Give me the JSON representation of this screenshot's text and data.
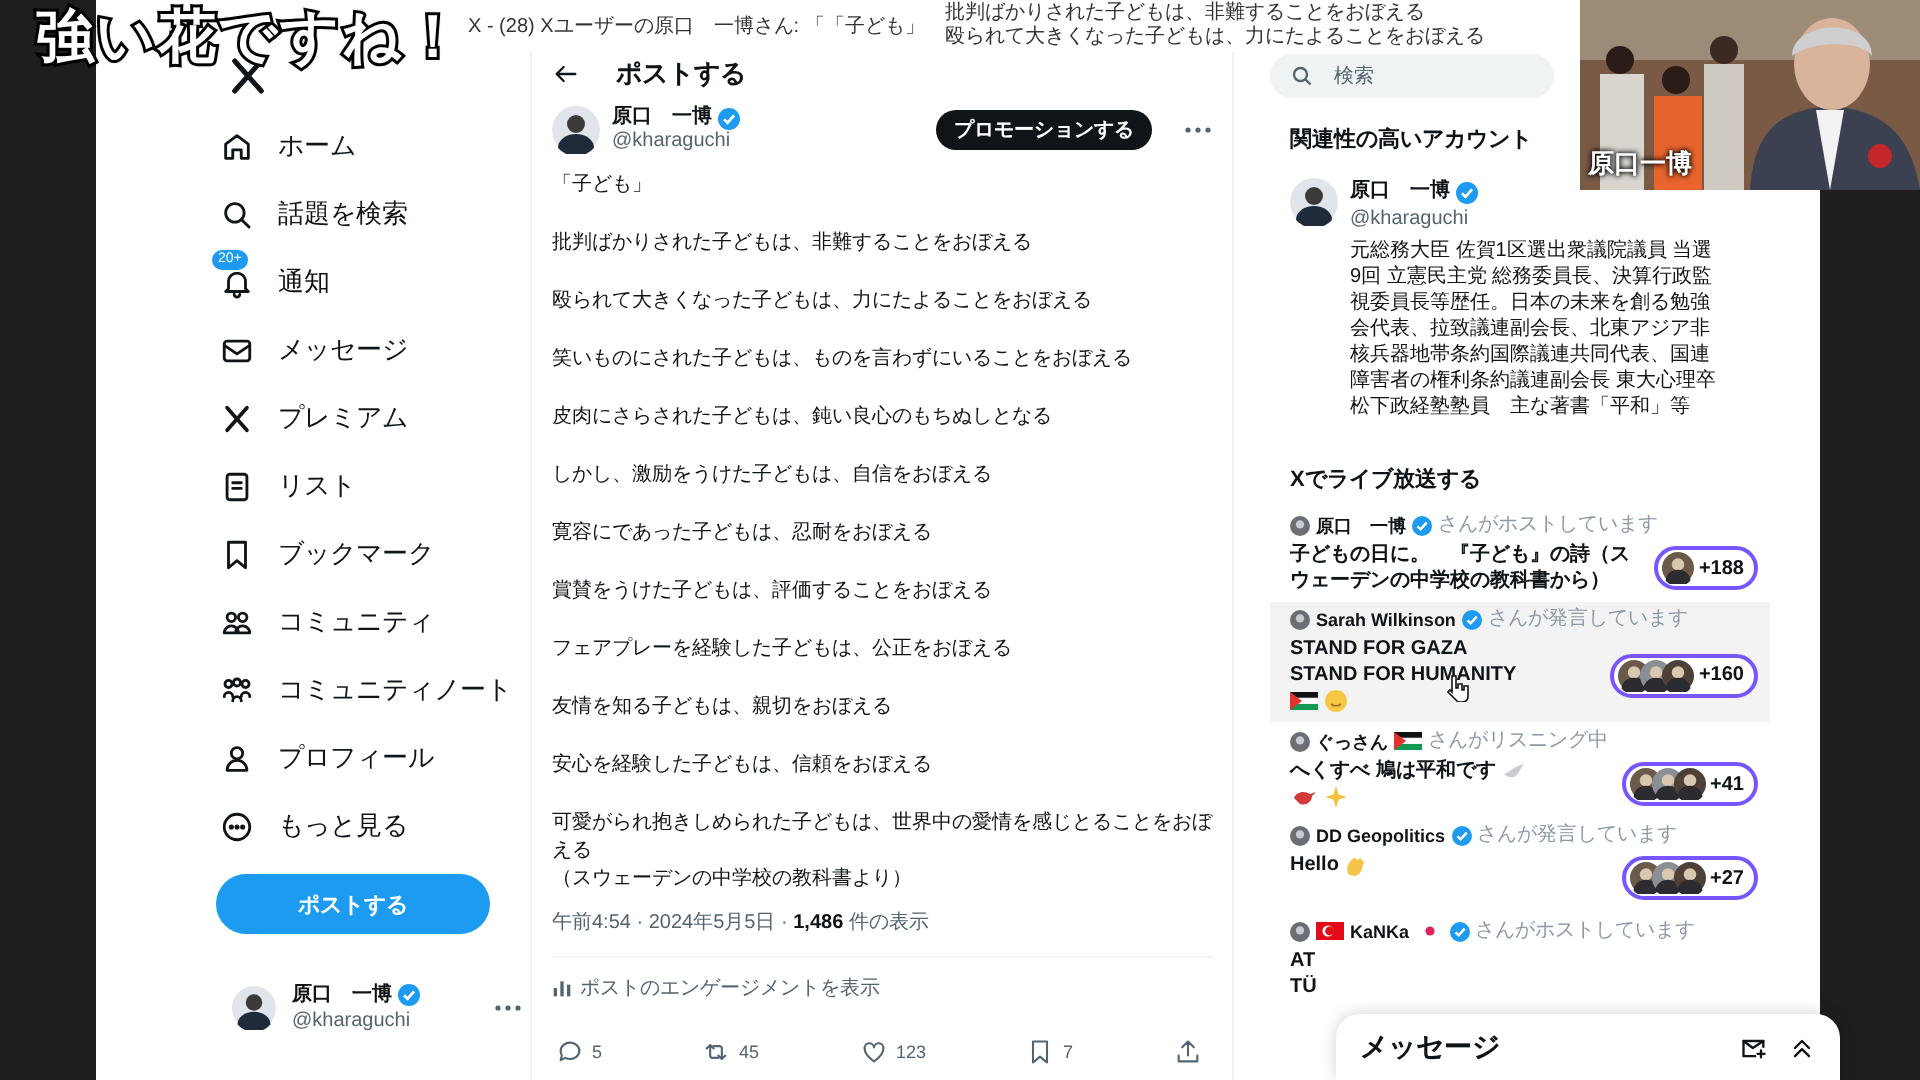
{
  "caption": {
    "text": "強い花ですね！"
  },
  "title_bar": {
    "page_title": "X - (28) Xユーザーの原口　一博さん: 「「子ども」",
    "post_preview": [
      "批判ばかりされた子どもは、非難することをおぼえる",
      "殴られて大きくなった子どもは、力にたよることをおぼえる"
    ]
  },
  "sidebar": {
    "items": [
      {
        "kind": "home",
        "label": "ホーム"
      },
      {
        "kind": "explore",
        "label": "話題を検索"
      },
      {
        "kind": "notifications",
        "label": "通知",
        "badge": "20+"
      },
      {
        "kind": "messages",
        "label": "メッセージ"
      },
      {
        "kind": "premium",
        "label": "プレミアム"
      },
      {
        "kind": "lists",
        "label": "リスト"
      },
      {
        "kind": "bookmarks",
        "label": "ブックマーク"
      },
      {
        "kind": "communities",
        "label": "コミュニティ"
      },
      {
        "kind": "notes",
        "label": "コミュニティノート"
      },
      {
        "kind": "profile",
        "label": "プロフィール"
      },
      {
        "kind": "more",
        "label": "もっと見る"
      }
    ],
    "post_button": "ポストする",
    "account": {
      "name": "原口　一博",
      "verified": true,
      "handle": "@kharaguchi"
    }
  },
  "post": {
    "header": "ポストする",
    "author": {
      "name": "原口　一博",
      "verified": true,
      "handle": "@kharaguchi"
    },
    "promote_button": "プロモーションする",
    "paragraphs": [
      "「子ども」",
      "批判ばかりされた子どもは、非難することをおぼえる",
      "殴られて大きくなった子どもは、力にたよることをおぼえる",
      "笑いものにされた子どもは、ものを言わずにいることをおぼえる",
      "皮肉にさらされた子どもは、鈍い良心のもちぬしとなる",
      "しかし、激励をうけた子どもは、自信をおぼえる",
      "寛容にであった子どもは、忍耐をおぼえる",
      "賞賛をうけた子どもは、評価することをおぼえる",
      "フェアプレーを経験した子どもは、公正をおぼえる",
      "友情を知る子どもは、親切をおぼえる",
      "安心を経験した子どもは、信頼をおぼえる",
      "可愛がられ抱きしめられた子どもは、世界中の愛情を感じとることをおぼえる"
    ],
    "source": "（スウェーデンの中学校の教科書より）",
    "meta": "午前4:54 · 2024年5月5日 · **1,486** 件の表示",
    "engagement_link": "ポストのエンゲージメントを表示",
    "actions": [
      {
        "kind": "reply",
        "count": "5"
      },
      {
        "kind": "repost",
        "count": "45"
      },
      {
        "kind": "like",
        "count": "123"
      },
      {
        "kind": "bookmark",
        "count": "7"
      },
      {
        "kind": "share"
      }
    ]
  },
  "right": {
    "search": {
      "placeholder": "検索"
    },
    "relevant": {
      "title": "関連性の高いアカウント",
      "account": {
        "name": "原口　一博",
        "verified": true,
        "handle": "@kharaguchi",
        "bio": "元総務大臣 佐賀1区選出衆議院議員 当選9回 立憲民主党 総務委員長、決算行政監視委員長等歴任。日本の未来を創る勉強会代表、拉致議連副会長、北東アジア非核兵器地帯条約国際議連共同代表、国連障害者の権利条約議連副会長 東大心理卒松下政経塾塾員　主な著書「平和」等"
      }
    },
    "spaces": {
      "title": "Xでライブ放送する",
      "items": [
        {
          "host": [
            {
              "kind": "text",
              "text": "原口　一博"
            }
          ],
          "verified": true,
          "status": "さんがホストしています",
          "title": [
            [
              {
                "kind": "text",
                "text": "子どもの日に。　『子ども』の詩（スウェーデンの中学校の教科書から）"
              }
            ]
          ],
          "avatars": [
            {
              "kind": "picture"
            }
          ],
          "listeners": "+188",
          "hovered": false
        },
        {
          "host": [
            {
              "kind": "text",
              "text": "Sarah Wilkinson"
            }
          ],
          "verified": true,
          "status": "さんが発言しています",
          "title": [
            [
              {
                "kind": "text",
                "text": "STAND FOR GAZA"
              }
            ],
            [
              {
                "kind": "text",
                "text": "STAND FOR HUMANITY"
              }
            ],
            [
              {
                "kind": "flag-ps"
              },
              {
                "kind": "face"
              }
            ]
          ],
          "avatars": [
            {
              "kind": "picture"
            },
            {
              "kind": "picture"
            },
            {
              "kind": "picture"
            }
          ],
          "listeners": "+160",
          "hovered": true
        },
        {
          "host": [
            {
              "kind": "text",
              "text": "ぐっさん"
            },
            {
              "kind": "flag-ps"
            }
          ],
          "verified": false,
          "status": "さんがリスニング中",
          "title": [
            [
              {
                "kind": "text",
                "text": "へくすべ 鳩は平和です"
              },
              {
                "kind": "dove"
              }
            ],
            [
              {
                "kind": "bird"
              },
              {
                "kind": "sparkles"
              }
            ]
          ],
          "avatars": [
            {
              "kind": "picture"
            },
            {
              "kind": "picture"
            },
            {
              "kind": "picture"
            }
          ],
          "listeners": "+41",
          "hovered": false
        },
        {
          "host": [
            {
              "kind": "text",
              "text": "DD Geopolitics"
            }
          ],
          "verified": true,
          "status": "さんが発言しています",
          "title": [
            [
              {
                "kind": "text",
                "text": "Hello"
              },
              {
                "kind": "clap"
              }
            ]
          ],
          "avatars": [
            {
              "kind": "picture"
            },
            {
              "kind": "picture"
            },
            {
              "kind": "picture"
            }
          ],
          "listeners": "+27",
          "hovered": false
        },
        {
          "host": [
            {
              "kind": "flag-tr"
            },
            {
              "kind": "text",
              "text": "KaNKa"
            },
            {
              "kind": "red-dot"
            }
          ],
          "verified": true,
          "status": "さんがホストしています",
          "title": [
            [
              {
                "kind": "text",
                "text": "AT"
              }
            ],
            [
              {
                "kind": "text",
                "text": "TÜ"
              }
            ]
          ],
          "hovered": false
        }
      ]
    }
  },
  "messages_dock": {
    "title": "メッセージ"
  },
  "webcam": {
    "kind": "picture",
    "name": "原口一博"
  }
}
